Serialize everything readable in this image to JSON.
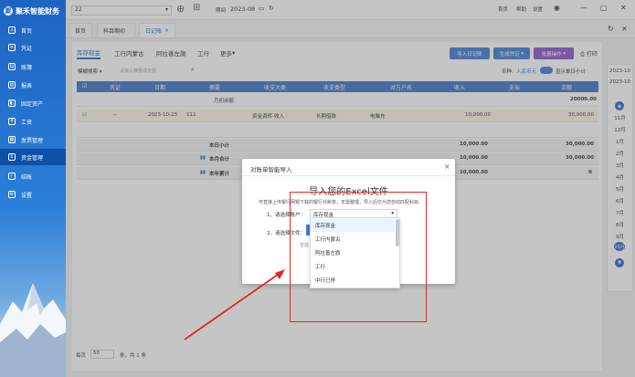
{
  "sidebar": {
    "logo": "聚禾智能财务",
    "items": [
      {
        "label": "首页",
        "icon": "home-icon"
      },
      {
        "label": "凭证",
        "icon": "voucher-icon"
      },
      {
        "label": "账簿",
        "icon": "ledger-icon"
      },
      {
        "label": "报表",
        "icon": "report-icon"
      },
      {
        "label": "固定资产",
        "icon": "asset-icon"
      },
      {
        "label": "工资",
        "icon": "salary-icon"
      },
      {
        "label": "发票管理",
        "icon": "invoice-icon"
      },
      {
        "label": "资金管理",
        "icon": "fund-icon"
      },
      {
        "label": "结账",
        "icon": "close-icon"
      },
      {
        "label": "设置",
        "icon": "gear-icon"
      }
    ]
  },
  "topbar": {
    "company_select": "22",
    "period_label": "期间",
    "period_value": "2023-08",
    "links": [
      "首页",
      "帮助",
      "设置"
    ]
  },
  "page_tabs": [
    "首页",
    "科目期初",
    "日记账"
  ],
  "subtabs": [
    "库存现金",
    "工行内蒙古",
    "阿拉善左旗",
    "工行",
    "更多"
  ],
  "toolbar": {
    "filter": "模糊搜索",
    "filter_placeholder": "请输入摘要或金额",
    "buttons": [
      "导入日记账",
      "生成凭证",
      "批量操作"
    ],
    "print": "打印",
    "currency_label": "币种:",
    "currency_value": "人民币元",
    "toggle_label": "显示单日小计"
  },
  "table": {
    "headers": [
      "凭证",
      "日期",
      "摘要",
      "收支大类",
      "收支类型",
      "对方户名",
      "收入",
      "支出",
      "余额"
    ],
    "opening": {
      "label": "月初余额",
      "balance": "20000.00"
    },
    "row": {
      "voucher": "--",
      "date": "2023-10-23",
      "summary": "111",
      "major": "资金调转-收入",
      "type": "长期借款",
      "counterparty": "电脑充",
      "income": "10,000.00",
      "balance": "30,000.00"
    },
    "subtotals": [
      {
        "label": "本日小计",
        "income": "10,000.00",
        "balance": "30,000.00"
      },
      {
        "label": "本月合计",
        "income": "10,000.00",
        "balance": "30,000.00"
      },
      {
        "label": "本年累计",
        "income": "10,000.00",
        "balance": "0"
      }
    ]
  },
  "pager": {
    "size_label": "每页",
    "size": "50",
    "total": "条，共 1 条"
  },
  "calendar": {
    "years": [
      "2023-10",
      "2023-10"
    ],
    "months": [
      "11月",
      "12月",
      "1月",
      "2月",
      "3月",
      "4月",
      "5月",
      "6月",
      "7月",
      "8月",
      "9月",
      "10月"
    ],
    "accent": "#2d6bc7"
  },
  "dialog": {
    "title": "对账单智能导入",
    "heading": "导入您的Excel文件",
    "desc": "可直接上传银行网银下载的银行对账单，无需整理，导入后交为您自动匹配科目。",
    "step1_label": "1、请选择账户：",
    "step1_value": "库存现金",
    "step2_label": "2、请选择文件：",
    "hint": "智能"
  },
  "dropdown_options": [
    "库存现金",
    "工行内蒙古",
    "阿拉善左旗",
    "工行",
    "中行已停"
  ],
  "colors": {
    "primary": "#1f6fd1",
    "header": "#3e75c8",
    "highlight": "#e0262b"
  }
}
